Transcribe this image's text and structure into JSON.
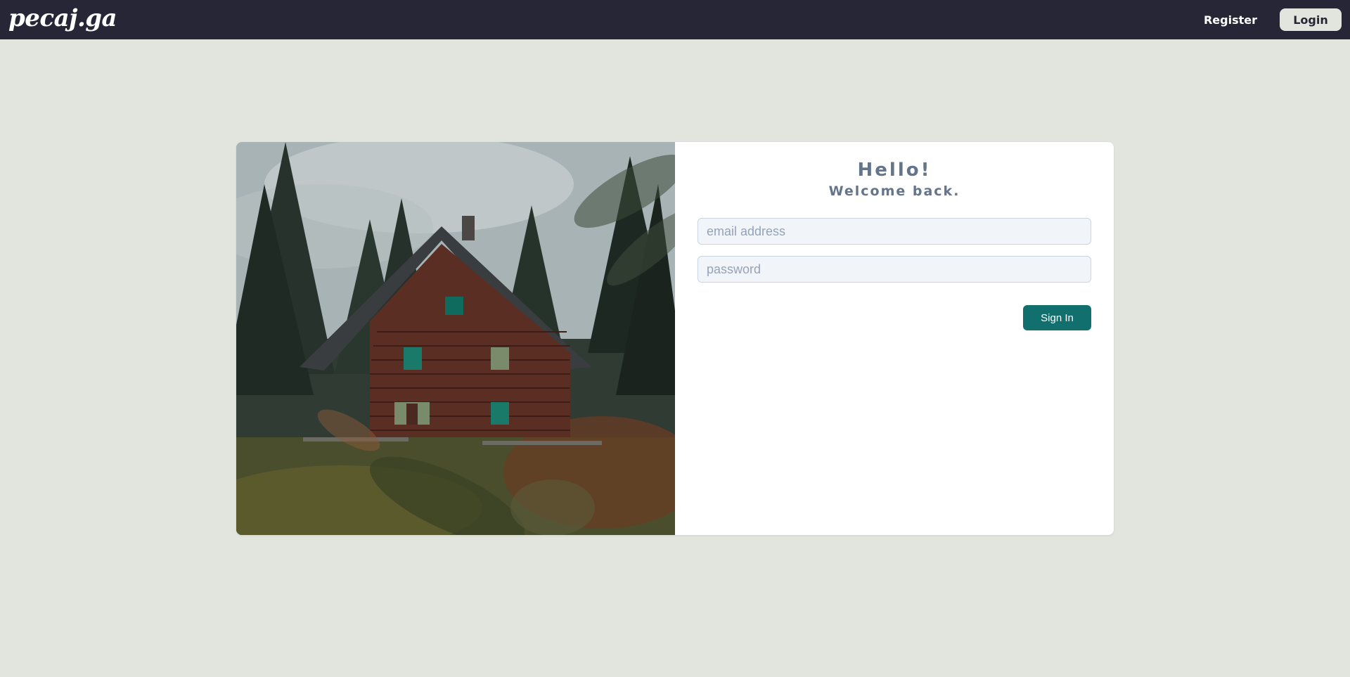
{
  "navbar": {
    "brand": "pecaj.ga",
    "register_label": "Register",
    "login_label": "Login"
  },
  "login_card": {
    "greeting": "Hello!",
    "subtitle": "Welcome back.",
    "email_placeholder": "email address",
    "email_value": "",
    "password_placeholder": "password",
    "password_value": "",
    "signin_label": "Sign In"
  },
  "colors": {
    "navbar_bg": "#262637",
    "page_bg": "#e2e5de",
    "accent": "#11706e",
    "heading_text": "#64748b"
  }
}
